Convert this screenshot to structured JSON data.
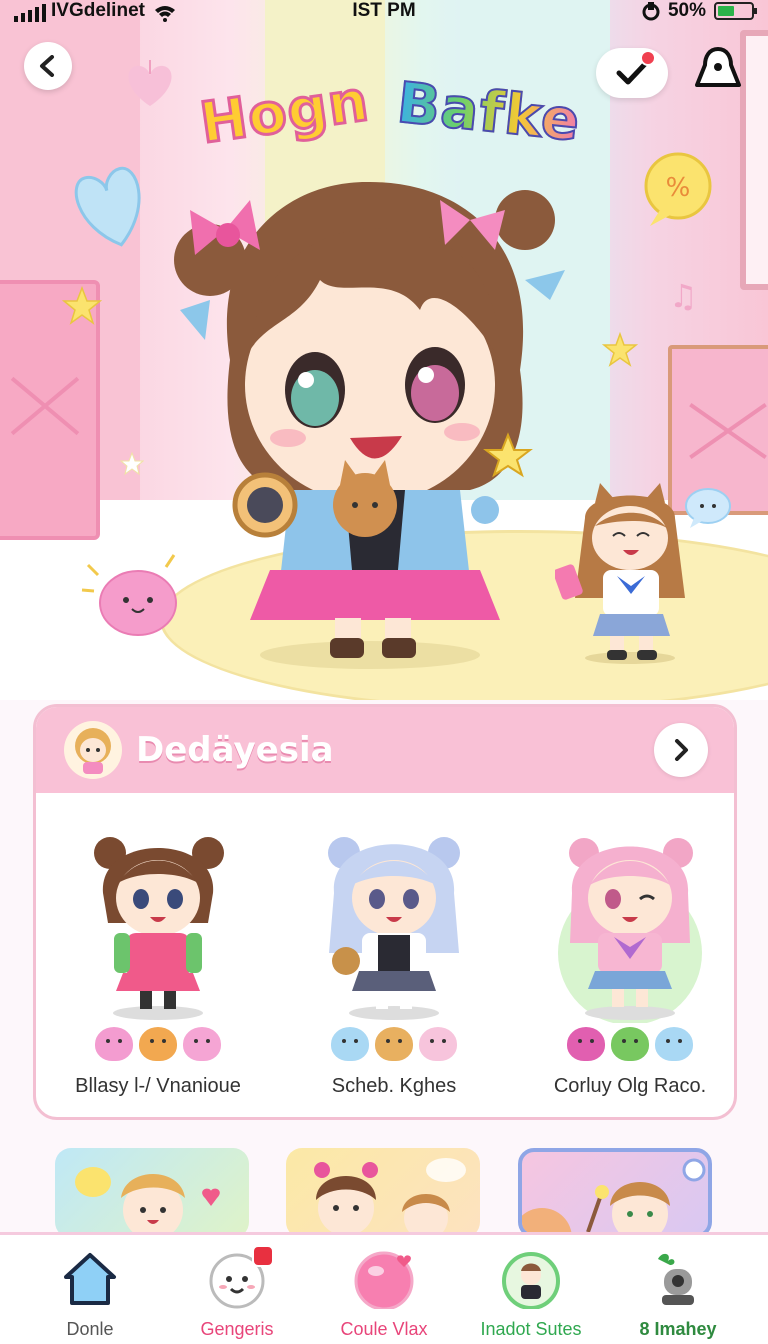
{
  "status_bar": {
    "carrier": "IVGdelinet",
    "time": "IST PM",
    "battery": "50%",
    "battery_level": 0.5
  },
  "header": {
    "logo_word_1": "Hogn",
    "logo_word_2": "Bafke",
    "back_icon": "chevron-left-icon",
    "check_icon": "checkmark-icon",
    "profile_icon": "user-lock-icon"
  },
  "featured": {
    "title": "Dedäyesia",
    "next_icon": "chevron-right-icon",
    "characters": [
      {
        "name": "Bllasy l-/ Vnaniоue"
      },
      {
        "name": "Schеb. Kghes"
      },
      {
        "name": "Corluy Olg Raco."
      }
    ]
  },
  "nav": {
    "items": [
      {
        "label": "Donle",
        "icon": "home-icon",
        "color": "#555555"
      },
      {
        "label": "Gengeris",
        "icon": "chat-face-icon",
        "color": "#e8457a"
      },
      {
        "label": "Coule Vlax",
        "icon": "heart-orb-icon",
        "color": "#e8457a"
      },
      {
        "label": "Inadot Sutes",
        "icon": "character-badge-icon",
        "color": "#2fa84f"
      },
      {
        "label": "8 Imahey",
        "icon": "robot-icon",
        "color": "#2f8a3f"
      }
    ]
  },
  "colors": {
    "accent_pink": "#f9c1d6",
    "nav_active": "#e8457a",
    "nav_green": "#2fa84f"
  }
}
